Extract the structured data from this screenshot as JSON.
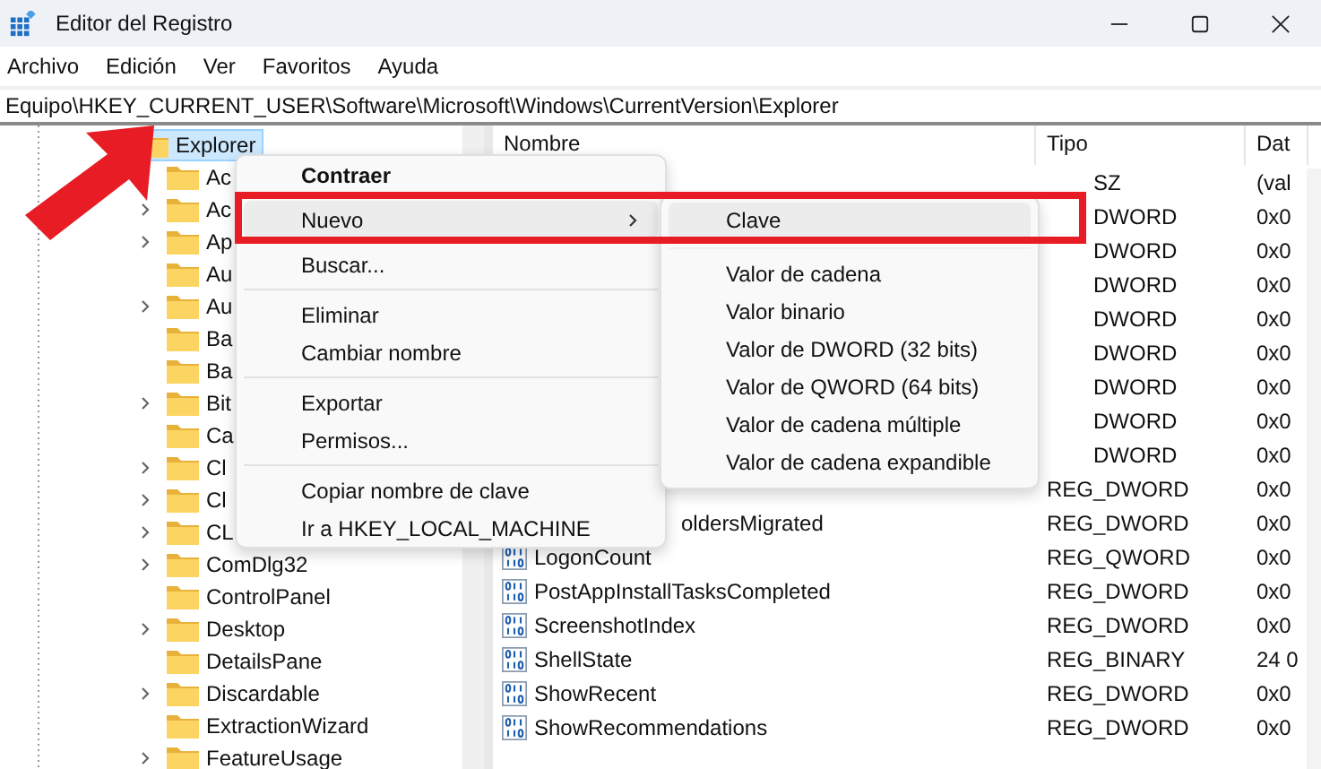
{
  "window": {
    "title": "Editor del Registro"
  },
  "menu_bar": [
    "Archivo",
    "Edición",
    "Ver",
    "Favoritos",
    "Ayuda"
  ],
  "address": "Equipo\\HKEY_CURRENT_USER\\Software\\Microsoft\\Windows\\CurrentVersion\\Explorer",
  "tree": [
    {
      "label": "Explorer",
      "expanded": true,
      "selected": true,
      "children": [
        {
          "label": "Ac",
          "has_children": false
        },
        {
          "label": "Ac",
          "has_children": true
        },
        {
          "label": "Ap",
          "has_children": true
        },
        {
          "label": "Au",
          "has_children": false
        },
        {
          "label": "Au",
          "has_children": true
        },
        {
          "label": "Ba",
          "has_children": false
        },
        {
          "label": "Ba",
          "has_children": false
        },
        {
          "label": "Bit",
          "has_children": true
        },
        {
          "label": "Ca",
          "has_children": false
        },
        {
          "label": "Cl",
          "has_children": true
        },
        {
          "label": "Cl",
          "has_children": true
        },
        {
          "label": "CL",
          "has_children": true
        },
        {
          "label": "ComDlg32",
          "has_children": true
        },
        {
          "label": "ControlPanel",
          "has_children": false
        },
        {
          "label": "Desktop",
          "has_children": true
        },
        {
          "label": "DetailsPane",
          "has_children": false
        },
        {
          "label": "Discardable",
          "has_children": true
        },
        {
          "label": "ExtractionWizard",
          "has_children": false
        },
        {
          "label": "FeatureUsage",
          "has_children": true
        }
      ]
    }
  ],
  "table": {
    "columns": [
      "Nombre",
      "Tipo",
      "Dat"
    ],
    "rows": [
      {
        "type_partial": "SZ",
        "data": "(val"
      },
      {
        "type_partial": "DWORD",
        "data": "0x0"
      },
      {
        "type_partial": "DWORD",
        "data": "0x0"
      },
      {
        "type_partial": "DWORD",
        "data": "0x0"
      },
      {
        "type_partial": "DWORD",
        "data": "0x0"
      },
      {
        "type_partial": "DWORD",
        "data": "0x0"
      },
      {
        "type_partial": "DWORD",
        "data": "0x0"
      },
      {
        "type_partial": "DWORD",
        "data": "0x0"
      },
      {
        "type_partial": "DWORD",
        "data": "0x0"
      },
      {
        "type": "REG_DWORD",
        "data": "0x0"
      },
      {
        "name_partial": "oldersMigrated",
        "type": "REG_DWORD",
        "data": "0x0"
      },
      {
        "name": "LogonCount",
        "type": "REG_QWORD",
        "data": "0x0"
      },
      {
        "name": "PostAppInstallTasksCompleted",
        "type": "REG_DWORD",
        "data": "0x0"
      },
      {
        "name": "ScreenshotIndex",
        "type": "REG_DWORD",
        "data": "0x0"
      },
      {
        "name": "ShellState",
        "type": "REG_BINARY",
        "data": "24 0"
      },
      {
        "name": "ShowRecent",
        "type": "REG_DWORD",
        "data": "0x0"
      },
      {
        "name": "ShowRecommendations",
        "type": "REG_DWORD",
        "data": "0x0"
      }
    ]
  },
  "context_menu": {
    "items": [
      {
        "kind": "item",
        "label": "Contraer",
        "bold": true,
        "highlighted": false
      },
      {
        "kind": "item",
        "label": "Nuevo",
        "bold": false,
        "highlighted": true,
        "submenu": true
      },
      {
        "kind": "item",
        "label": "Buscar...",
        "bold": false,
        "highlighted": false
      },
      {
        "kind": "separator"
      },
      {
        "kind": "item",
        "label": "Eliminar",
        "bold": false,
        "highlighted": false
      },
      {
        "kind": "item",
        "label": "Cambiar nombre",
        "bold": false,
        "highlighted": false
      },
      {
        "kind": "separator"
      },
      {
        "kind": "item",
        "label": "Exportar",
        "bold": false,
        "highlighted": false
      },
      {
        "kind": "item",
        "label": "Permisos...",
        "bold": false,
        "highlighted": false
      },
      {
        "kind": "separator"
      },
      {
        "kind": "item",
        "label": "Copiar nombre de clave",
        "bold": false,
        "highlighted": false
      },
      {
        "kind": "item",
        "label": "Ir a HKEY_LOCAL_MACHINE",
        "bold": false,
        "highlighted": false
      }
    ]
  },
  "submenu": {
    "items": [
      {
        "kind": "item",
        "label": "Clave",
        "highlighted": true
      },
      {
        "kind": "separator"
      },
      {
        "kind": "item",
        "label": "Valor de cadena",
        "highlighted": false
      },
      {
        "kind": "item",
        "label": "Valor binario",
        "highlighted": false
      },
      {
        "kind": "item",
        "label": "Valor de DWORD (32 bits)",
        "highlighted": false
      },
      {
        "kind": "item",
        "label": "Valor de QWORD (64 bits)",
        "highlighted": false
      },
      {
        "kind": "item",
        "label": "Valor de cadena múltiple",
        "highlighted": false
      },
      {
        "kind": "item",
        "label": "Valor de cadena expandible",
        "highlighted": false
      }
    ]
  }
}
